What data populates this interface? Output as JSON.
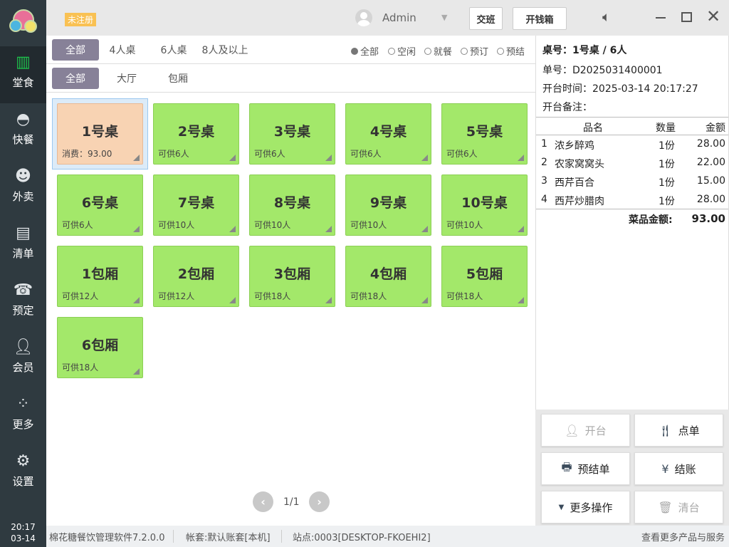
{
  "topbar": {
    "badge": "未注册",
    "user": "Admin",
    "handover": "交班",
    "open_drawer": "开钱箱"
  },
  "sidebar": {
    "items": [
      {
        "label": "堂食",
        "icon": "store-icon"
      },
      {
        "label": "快餐",
        "icon": "cloche-icon"
      },
      {
        "label": "外卖",
        "icon": "delivery-icon"
      },
      {
        "label": "清单",
        "icon": "clipboard-icon"
      },
      {
        "label": "预定",
        "icon": "phone-icon"
      },
      {
        "label": "会员",
        "icon": "user-icon"
      },
      {
        "label": "更多",
        "icon": "grid-icon"
      },
      {
        "label": "设置",
        "icon": "gear-icon"
      }
    ],
    "time": "20:17",
    "date": "03-14"
  },
  "filters": {
    "size": [
      "全部",
      "4人桌",
      "6人桌",
      "8人及以上"
    ],
    "area": [
      "全部",
      "大厅",
      "包厢"
    ],
    "status": [
      "全部",
      "空闲",
      "就餐",
      "预订",
      "预结"
    ]
  },
  "tables": [
    {
      "name": "1号桌",
      "sub": "消费：93.00",
      "busy": true
    },
    {
      "name": "2号桌",
      "sub": "可供6人"
    },
    {
      "name": "3号桌",
      "sub": "可供6人"
    },
    {
      "name": "4号桌",
      "sub": "可供6人"
    },
    {
      "name": "5号桌",
      "sub": "可供6人"
    },
    {
      "name": "6号桌",
      "sub": "可供6人"
    },
    {
      "name": "7号桌",
      "sub": "可供10人"
    },
    {
      "name": "8号桌",
      "sub": "可供10人"
    },
    {
      "name": "9号桌",
      "sub": "可供10人"
    },
    {
      "name": "10号桌",
      "sub": "可供10人"
    },
    {
      "name": "1包厢",
      "sub": "可供12人"
    },
    {
      "name": "2包厢",
      "sub": "可供12人"
    },
    {
      "name": "3包厢",
      "sub": "可供18人"
    },
    {
      "name": "4包厢",
      "sub": "可供18人"
    },
    {
      "name": "5包厢",
      "sub": "可供18人"
    },
    {
      "name": "6包厢",
      "sub": "可供18人"
    }
  ],
  "pagination": {
    "page": "1/1"
  },
  "order": {
    "table": "桌号：1号桌 / 6人",
    "number": "单号：D2025031400001",
    "open_time": "开台时间：2025-03-14 20:17:27",
    "note": "开台备注：",
    "headers": [
      "品名",
      "数量",
      "金额"
    ],
    "items": [
      {
        "no": "1",
        "name": "浓乡醉鸡",
        "qty": "1份",
        "amount": "28.00"
      },
      {
        "no": "2",
        "name": "农家窝窝头",
        "qty": "1份",
        "amount": "22.00"
      },
      {
        "no": "3",
        "name": "西芹百合",
        "qty": "1份",
        "amount": "15.00"
      },
      {
        "no": "4",
        "name": "西芹炒腊肉",
        "qty": "1份",
        "amount": "28.00"
      }
    ],
    "total_label": "菜品金额:",
    "total": "93.00"
  },
  "actions": [
    {
      "label": "开台",
      "icon": "user-icon",
      "disabled": true
    },
    {
      "label": "点单",
      "icon": "utensils-icon"
    },
    {
      "label": "预结单",
      "icon": "printer-icon"
    },
    {
      "label": "结账",
      "icon": "yen-icon"
    },
    {
      "label": "更多操作",
      "icon": "caret-down-icon"
    },
    {
      "label": "清台",
      "icon": "trash-icon",
      "disabled": true
    }
  ],
  "status": {
    "software": "棉花糖餐饮管理软件7.2.0.0",
    "account": "帐套:默认账套[本机]",
    "station": "站点:0003[DESKTOP-FKOEHI2]",
    "more": "查看更多产品与服务"
  }
}
